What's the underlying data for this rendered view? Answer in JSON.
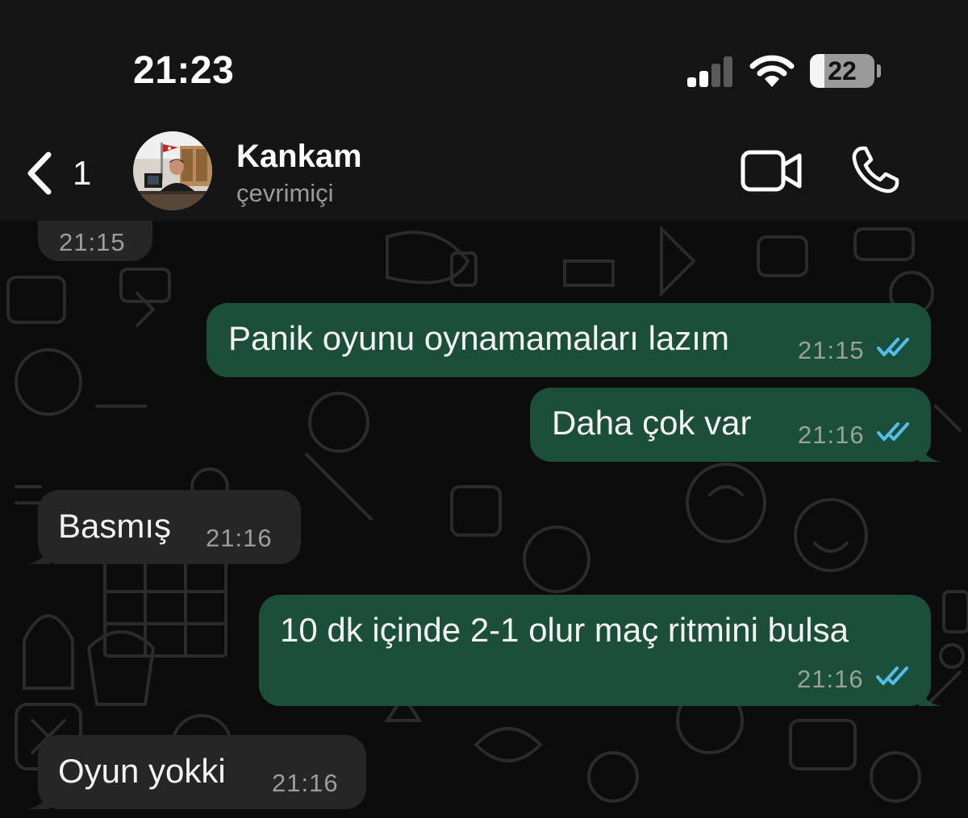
{
  "status_bar": {
    "time": "21:23",
    "battery_level": "22",
    "icons": [
      "cellular-signal-icon",
      "wifi-icon",
      "battery-icon"
    ]
  },
  "header": {
    "back_count": "1",
    "contact_name": "Kankam",
    "contact_status": "çevrimiçi",
    "icons": [
      "back-chevron-icon",
      "video-call-icon",
      "phone-call-icon"
    ]
  },
  "messages": [
    {
      "direction": "in",
      "text": "",
      "time": "21:15"
    },
    {
      "direction": "out",
      "text": "Panik oyunu oynamamaları lazım",
      "time": "21:15",
      "status": "read"
    },
    {
      "direction": "out",
      "text": "Daha çok var",
      "time": "21:16",
      "status": "read"
    },
    {
      "direction": "in",
      "text": "Basmış",
      "time": "21:16"
    },
    {
      "direction": "out",
      "text": "10 dk içinde 2-1 olur maç ritmini bulsa",
      "time": "21:16",
      "status": "read"
    },
    {
      "direction": "in",
      "text": "Oyun yokki",
      "time": "21:16"
    }
  ],
  "colors": {
    "outgoing_bubble": "#1c4f3a",
    "incoming_bubble": "#262626",
    "read_ticks": "#53bdeb",
    "header_bg": "#151515"
  }
}
